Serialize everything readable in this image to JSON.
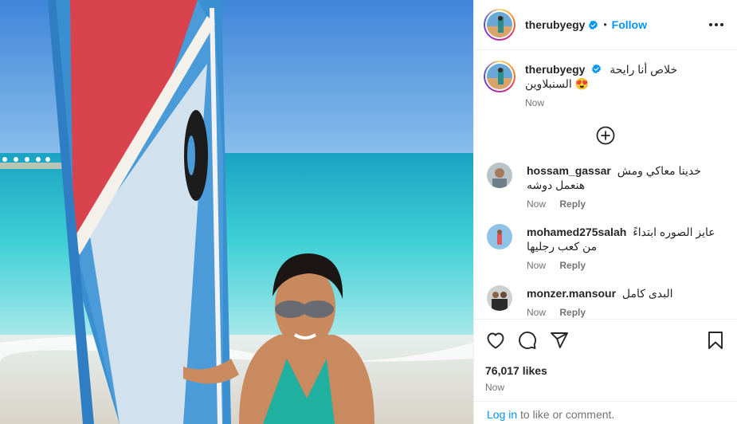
{
  "post": {
    "username": "therubyegy",
    "follow_label": "Follow",
    "dot": "•",
    "caption": "خلاص أنا رايحة السنبلاوين 😍",
    "caption_time": "Now",
    "likes": "76,017 likes",
    "post_time": "Now"
  },
  "comments": [
    {
      "user": "hossam_gassar",
      "text": "خدينا معاكي ومش هنعمل دوشه",
      "time": "Now",
      "reply": "Reply"
    },
    {
      "user": "mohamed275salah",
      "text": "عايز الصوره ابتداءً من كعب رجليها",
      "time": "Now",
      "reply": "Reply"
    },
    {
      "user": "monzer.mansour",
      "text": "البدى كامل",
      "time": "Now",
      "reply": "Reply"
    }
  ],
  "login": {
    "link": "Log in",
    "rest": " to like or comment."
  },
  "icons": {
    "verified": "verified-badge-icon",
    "more": "more-options-icon",
    "load_more": "plus-circle-icon",
    "like": "heart-icon",
    "comment": "comment-bubble-icon",
    "share": "paper-plane-icon",
    "save": "bookmark-icon"
  },
  "colors": {
    "accent": "#0095f6",
    "verified": "#0095f6",
    "text": "#262626",
    "muted": "#737373",
    "divider": "#efefef"
  }
}
